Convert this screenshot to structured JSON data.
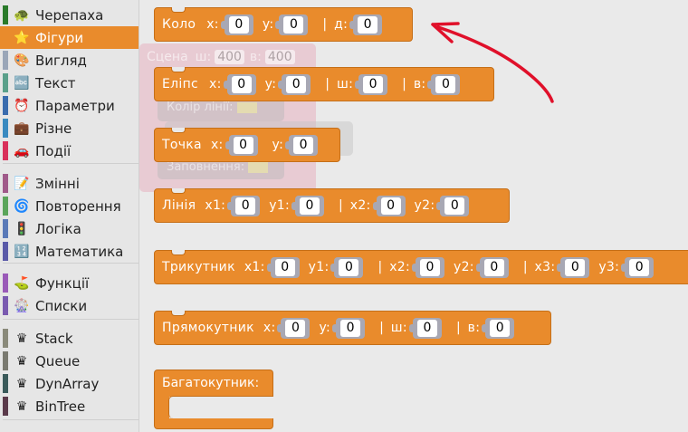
{
  "sidebar": {
    "categories": [
      {
        "label": "Черепаха",
        "icon": "turtle-icon",
        "glyph": "🐢",
        "color": "#2a7a2a",
        "selected": false
      },
      {
        "label": "Фігури",
        "icon": "shapes-icon",
        "glyph": "⭐",
        "color": "#e98b2c",
        "selected": true
      },
      {
        "label": "Вигляд",
        "icon": "palette-icon",
        "glyph": "🎨",
        "color": "#9aa6b8",
        "selected": false
      },
      {
        "label": "Текст",
        "icon": "text-abc-icon",
        "glyph": "🔤",
        "color": "#5aa08a",
        "selected": false
      },
      {
        "label": "Параметри",
        "icon": "alarm-clock-icon",
        "glyph": "⏰",
        "color": "#3a6cae",
        "selected": false
      },
      {
        "label": "Різне",
        "icon": "briefcase-icon",
        "glyph": "💼",
        "color": "#3a8ac0",
        "selected": false
      },
      {
        "label": "Події",
        "icon": "car-icon",
        "glyph": "🚗",
        "color": "#d9305a",
        "selected": false
      },
      {
        "label": "Змінні",
        "icon": "pencil-note-icon",
        "glyph": "📝",
        "color": "#a05a8a",
        "selected": false
      },
      {
        "label": "Повторення",
        "icon": "loop-icon",
        "glyph": "🌀",
        "color": "#5ba55b",
        "selected": false
      },
      {
        "label": "Логіка",
        "icon": "traffic-light-icon",
        "glyph": "🚦",
        "color": "#5a7ab8",
        "selected": false
      },
      {
        "label": "Математика",
        "icon": "numbers-icon",
        "glyph": "🔢",
        "color": "#5a5aa8",
        "selected": false
      },
      {
        "label": "Функції",
        "icon": "golf-flag-icon",
        "glyph": "⛳",
        "color": "#9a5ab8",
        "selected": false
      },
      {
        "label": "Списки",
        "icon": "ferris-wheel-icon",
        "glyph": "🎡",
        "color": "#7a5ab0",
        "selected": false
      },
      {
        "label": "Stack",
        "icon": "crown-icon",
        "glyph": "♛",
        "color": "#8a8a7a",
        "selected": false
      },
      {
        "label": "Queue",
        "icon": "crown-icon",
        "glyph": "♛",
        "color": "#7a7a70",
        "selected": false
      },
      {
        "label": "DynArray",
        "icon": "crown-icon",
        "glyph": "♛",
        "color": "#3a5a5a",
        "selected": false
      },
      {
        "label": "BinTree",
        "icon": "crown-icon",
        "glyph": "♛",
        "color": "#5a3a4a",
        "selected": false
      }
    ]
  },
  "ghost": {
    "scene_label": "Сцена",
    "w_label": "ш:",
    "w_value": "400",
    "h_label": "в:",
    "h_value": "400",
    "line_color_label": "Колір лінії:",
    "fill_label": "Заповнення:"
  },
  "blocks": {
    "circle": {
      "title": "Коло",
      "x_label": "x:",
      "x": "0",
      "y_label": "y:",
      "y": "0",
      "sep": "|",
      "d_label": "д:",
      "d": "0"
    },
    "ellipse": {
      "title": "Еліпс",
      "x_label": "x:",
      "x": "0",
      "y_label": "y:",
      "y": "0",
      "w_label": "ш:",
      "w": "0",
      "h_label": "в:",
      "h": "0",
      "sep": "|"
    },
    "point": {
      "title": "Точка",
      "x_label": "x:",
      "x": "0",
      "y_label": "y:",
      "y": "0"
    },
    "line": {
      "title": "Лінія",
      "x1_label": "x1:",
      "x1": "0",
      "y1_label": "y1:",
      "y1": "0",
      "x2_label": "x2:",
      "x2": "0",
      "y2_label": "y2:",
      "y2": "0",
      "sep": "|"
    },
    "triangle": {
      "title": "Трикутник",
      "x1_label": "x1:",
      "x1": "0",
      "y1_label": "y1:",
      "y1": "0",
      "x2_label": "x2:",
      "x2": "0",
      "y2_label": "y2:",
      "y2": "0",
      "x3_label": "x3:",
      "x3": "0",
      "y3_label": "y3:",
      "y3": "0",
      "sep": "|"
    },
    "rectangle": {
      "title": "Прямокутник",
      "x_label": "x:",
      "x": "0",
      "y_label": "y:",
      "y": "0",
      "w_label": "ш:",
      "w": "0",
      "h_label": "в:",
      "h": "0",
      "sep": "|"
    },
    "polygon": {
      "title": "Багатокутник:"
    }
  },
  "annotation": {
    "arrow_color": "#e0102a"
  },
  "colors": {
    "block": "#e98b2c",
    "block_border": "#c56f18",
    "slot": "#a8a8b4",
    "ghost_scene": "#e8a0b0"
  }
}
